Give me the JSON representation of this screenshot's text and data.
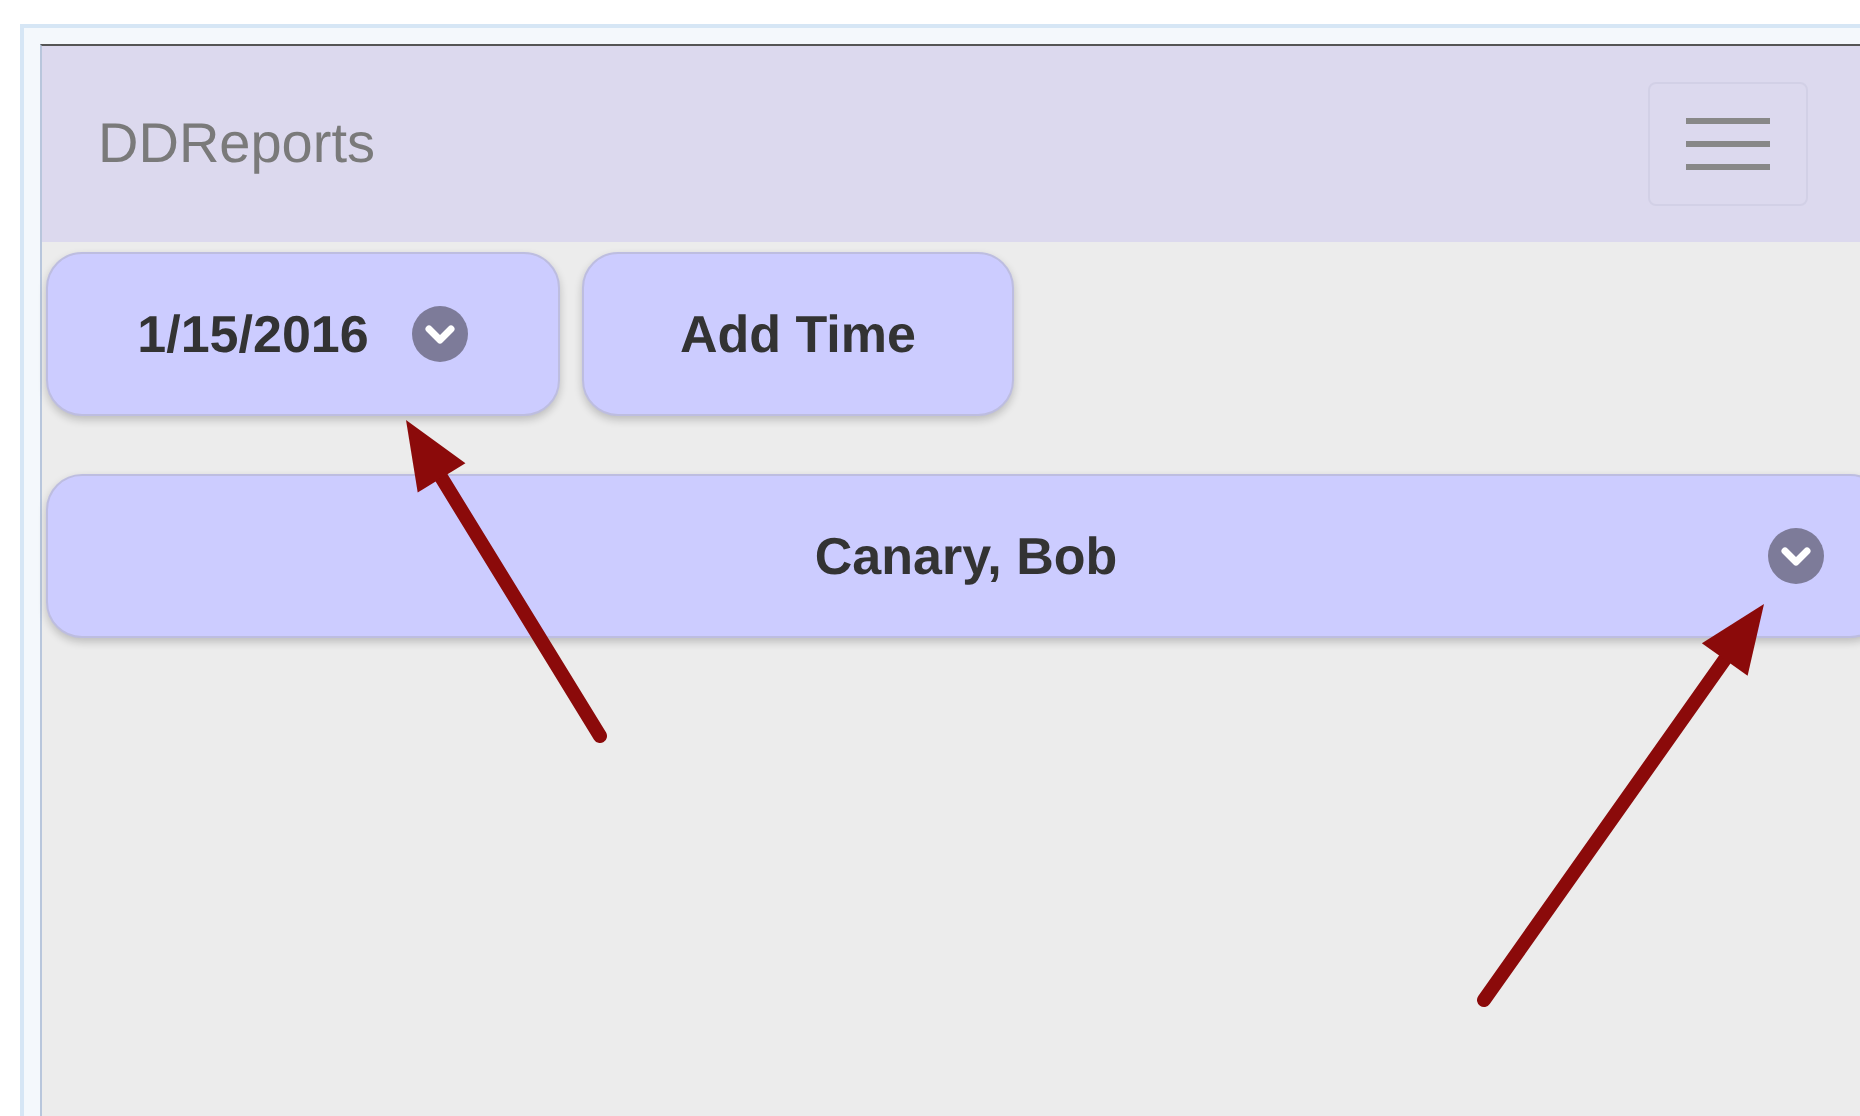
{
  "header": {
    "title": "DDReports"
  },
  "toolbar": {
    "date_button": {
      "label": "1/15/2016"
    },
    "add_time_button": {
      "label": "Add Time"
    }
  },
  "employee_select": {
    "value": "Canary, Bob"
  }
}
